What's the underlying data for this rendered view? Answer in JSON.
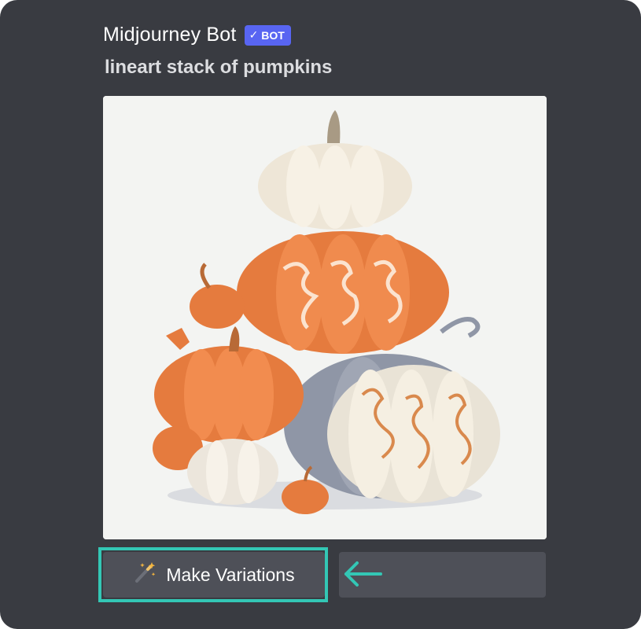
{
  "message": {
    "author": "Midjourney Bot",
    "badge": {
      "check": "✓",
      "label": "BOT"
    },
    "prompt": "lineart stack of pumpkins"
  },
  "image": {
    "subject": "stack of pumpkins"
  },
  "buttons": {
    "make_variations": {
      "label": "Make Variations",
      "icon": "magic-wand-icon"
    }
  },
  "annotation": {
    "highlight_color": "#33c7b5",
    "arrow_icon": "arrow-left-icon"
  },
  "colors": {
    "panel_bg": "#393b41",
    "button_bg": "#4e5058",
    "badge_bg": "#5865f2",
    "highlight": "#33c7b5"
  }
}
